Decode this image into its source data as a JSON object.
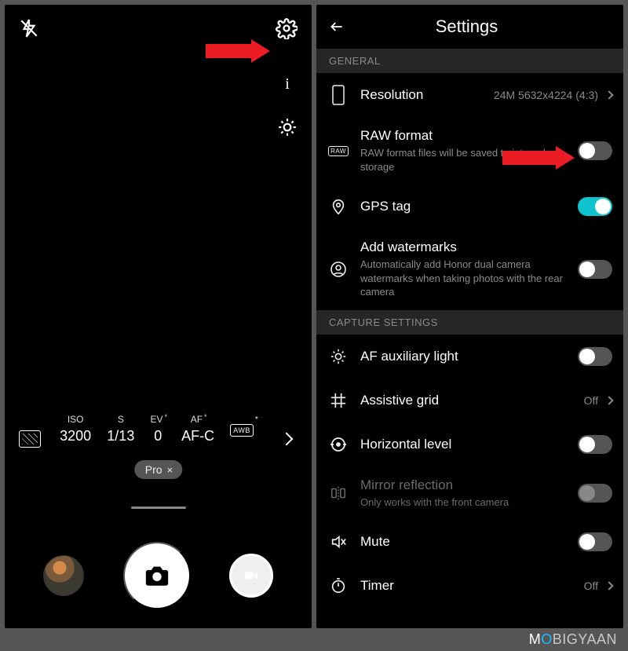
{
  "left": {
    "flash_state": "off",
    "info_label": "i",
    "pro_readout": {
      "iso": {
        "label": "ISO",
        "value": "3200"
      },
      "shutter": {
        "label": "S",
        "value": "1/13"
      },
      "ev": {
        "label": "EV",
        "star": "*",
        "value": "0"
      },
      "af": {
        "label": "AF",
        "star": "*",
        "value": "AF-C"
      },
      "awb": {
        "label": "AWB",
        "star": "*"
      }
    },
    "mode_pill": {
      "label": "Pro",
      "close": "×"
    }
  },
  "right": {
    "title": "Settings",
    "sections": {
      "general": "GENERAL",
      "capture": "CAPTURE SETTINGS"
    },
    "items": {
      "resolution": {
        "title": "Resolution",
        "value": "24M 5632x4224 (4:3)"
      },
      "raw": {
        "title": "RAW format",
        "sub": "RAW format files will be saved to internal storage",
        "on": false
      },
      "gps": {
        "title": "GPS tag",
        "on": true
      },
      "watermark": {
        "title": "Add watermarks",
        "sub": "Automatically add Honor dual camera watermarks when taking photos with the rear camera",
        "on": false
      },
      "af_aux": {
        "title": "AF auxiliary light",
        "on": false
      },
      "grid": {
        "title": "Assistive grid",
        "value": "Off"
      },
      "horizon": {
        "title": "Horizontal level",
        "on": false
      },
      "mirror": {
        "title": "Mirror reflection",
        "sub": "Only works with the front camera",
        "on": false,
        "disabled": true
      },
      "mute": {
        "title": "Mute",
        "on": false
      },
      "timer": {
        "title": "Timer",
        "value": "Off"
      }
    }
  },
  "watermark": {
    "m": "M",
    "o": "O",
    "rest": "BIGYAAN"
  }
}
